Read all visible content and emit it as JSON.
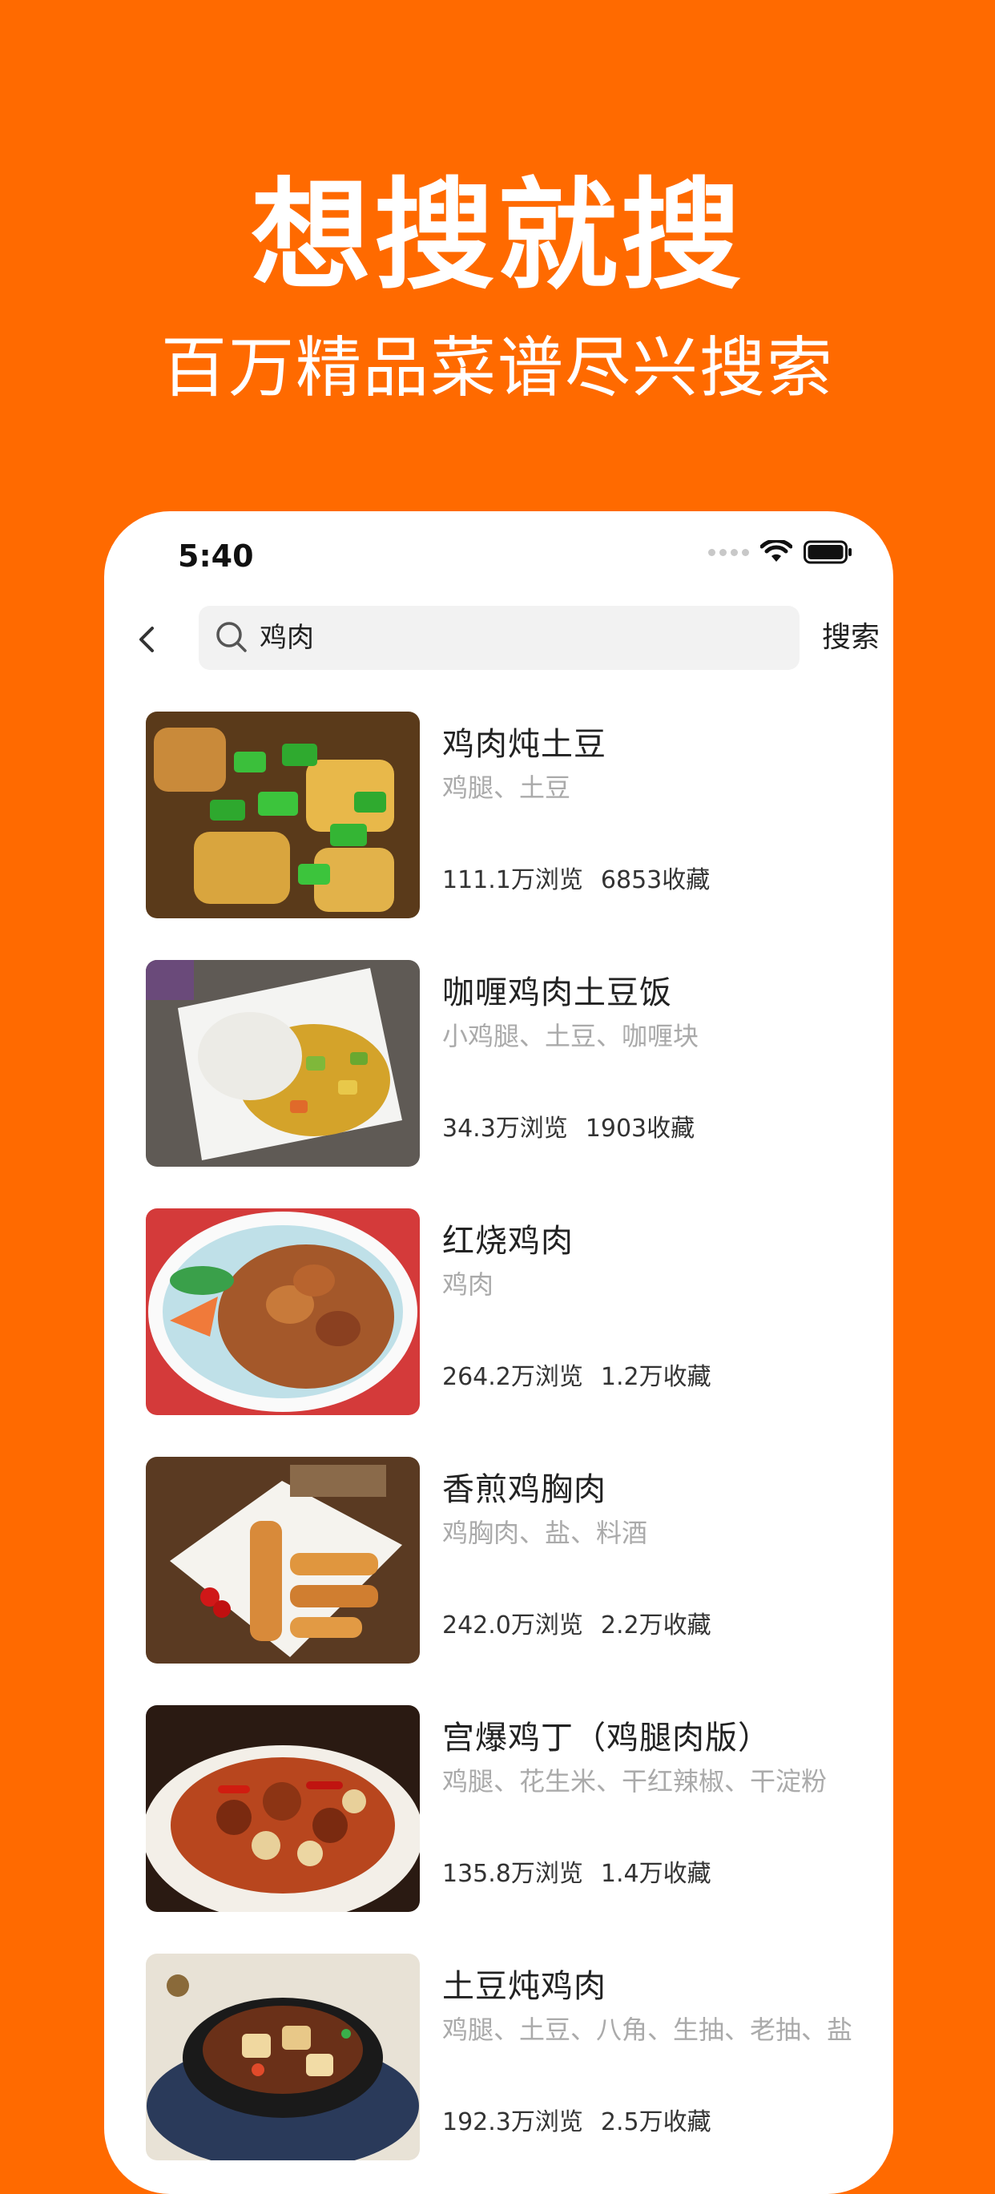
{
  "hero": {
    "title": "想搜就搜",
    "subtitle": "百万精品菜谱尽兴搜索"
  },
  "status_bar": {
    "time": "5:40"
  },
  "search": {
    "query": "鸡肉",
    "button_label": "搜索"
  },
  "recipes": [
    {
      "title": "鸡肉炖土豆",
      "ingredients": "鸡腿、土豆",
      "views": "111.1万浏览",
      "favorites": "6853收藏"
    },
    {
      "title": "咖喱鸡肉土豆饭",
      "ingredients": "小鸡腿、土豆、咖喱块",
      "views": "34.3万浏览",
      "favorites": "1903收藏"
    },
    {
      "title": "红烧鸡肉",
      "ingredients": "鸡肉",
      "views": "264.2万浏览",
      "favorites": "1.2万收藏"
    },
    {
      "title": "香煎鸡胸肉",
      "ingredients": "鸡胸肉、盐、料酒",
      "views": "242.0万浏览",
      "favorites": "2.2万收藏"
    },
    {
      "title": "宫爆鸡丁（鸡腿肉版）",
      "ingredients": "鸡腿、花生米、干红辣椒、干淀粉",
      "views": "135.8万浏览",
      "favorites": "1.4万收藏"
    },
    {
      "title": "土豆炖鸡肉",
      "ingredients": "鸡腿、土豆、八角、生抽、老抽、盐",
      "views": "192.3万浏览",
      "favorites": "2.5万收藏"
    }
  ],
  "colors": {
    "brand_orange": "#FF6A00",
    "text_primary": "#222222",
    "text_secondary": "#AAAAAA",
    "search_bg": "#F2F2F2"
  }
}
